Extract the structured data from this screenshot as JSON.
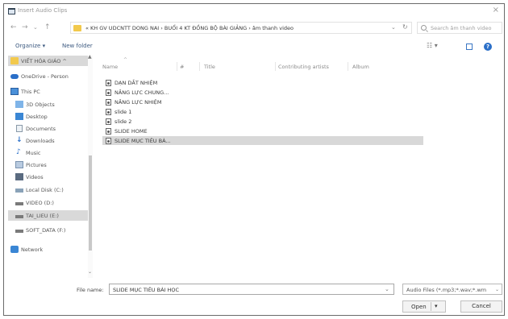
{
  "window": {
    "title": "Insert Audio Clips",
    "close_glyph": "×"
  },
  "nav": {
    "back": "←",
    "forward": "→",
    "recent": "⌄",
    "up": "↑",
    "address_path": "« KH GV UDCNTT DONG NAI › BUỔI 4 KT ĐỒNG BỘ BÀI GIẢNG › âm thanh video",
    "address_dropdown": "⌄",
    "refresh": "↻",
    "search_placeholder": "Search âm thanh video"
  },
  "toolbar": {
    "organize": "Organize ▾",
    "new_folder": "New folder",
    "view_glyph": "☷ ▾",
    "help_glyph": "?"
  },
  "sidebar": {
    "items": [
      {
        "label": "VIẾT HÓA GIÁO ^",
        "icon": "folder-icon",
        "selected": true
      },
      {
        "label": "OneDrive - Person",
        "icon": "onedrive-icon",
        "selected": false
      },
      {
        "label": "This PC",
        "icon": "computer-icon",
        "selected": false
      },
      {
        "label": "3D Objects",
        "icon": "3d-objects-icon",
        "selected": false
      },
      {
        "label": "Desktop",
        "icon": "desktop-icon",
        "selected": false
      },
      {
        "label": "Documents",
        "icon": "documents-icon",
        "selected": false
      },
      {
        "label": "Downloads",
        "icon": "downloads-icon",
        "selected": false
      },
      {
        "label": "Music",
        "icon": "music-icon",
        "selected": false
      },
      {
        "label": "Pictures",
        "icon": "pictures-icon",
        "selected": false
      },
      {
        "label": "Videos",
        "icon": "videos-icon",
        "selected": false
      },
      {
        "label": "Local Disk (C:)",
        "icon": "drive-icon",
        "selected": false
      },
      {
        "label": "VIDEO (D:)",
        "icon": "drive-icon",
        "selected": false
      },
      {
        "label": "TAI_LIEU (E:)",
        "icon": "drive-icon",
        "selected": true
      },
      {
        "label": "SOFT_DATA (F:)",
        "icon": "drive-icon",
        "selected": false
      },
      {
        "label": "Network",
        "icon": "network-icon",
        "selected": false
      }
    ],
    "scroll_up": "▲",
    "scroll_down": "⌄"
  },
  "list": {
    "columns": [
      "Name",
      "#",
      "Title",
      "Contributing artists",
      "Album"
    ],
    "sort_caret": "^",
    "files": [
      {
        "name": "DẠN DẮT NHIỆM",
        "selected": false
      },
      {
        "name": "NĂNG LỰC CHUNG...",
        "selected": false
      },
      {
        "name": "NĂNG LỰC NHIỆM",
        "selected": false
      },
      {
        "name": "slide 1",
        "selected": false
      },
      {
        "name": "slide 2",
        "selected": false
      },
      {
        "name": "SLIDE HOME",
        "selected": false
      },
      {
        "name": "SLIDE MỤC TIÊU BÀ...",
        "selected": true
      }
    ]
  },
  "footer": {
    "file_name_label": "File name:",
    "file_name_value": "SLIDE MỤC TIÊU BÀI HỌC",
    "file_name_dropdown": "⌄",
    "file_type": "Audio Files (*.mp3;*.wav;*.wm",
    "file_type_dropdown": "⌄",
    "open_label": "Open",
    "open_dropdown": "▾",
    "cancel_label": "Cancel"
  },
  "colors": {
    "accent": "#2a6fc8",
    "folder": "#f2c94c",
    "selection": "#d8d8d8"
  }
}
